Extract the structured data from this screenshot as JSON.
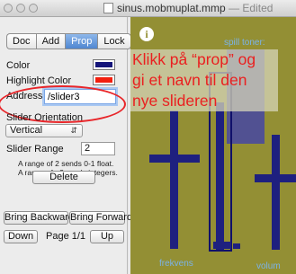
{
  "window": {
    "filename": "sinus.mobmuplat.mmp",
    "separator": "—",
    "state": "Edited"
  },
  "sidebar": {
    "tabs": [
      {
        "label": "Doc",
        "selected": false
      },
      {
        "label": "Add",
        "selected": false
      },
      {
        "label": "Prop",
        "selected": true
      },
      {
        "label": "Lock",
        "selected": false
      }
    ],
    "color_label": "Color",
    "color_value": "#15157a",
    "highlight_label": "Highlight Color",
    "highlight_value": "#f21e0e",
    "address_label": "Address",
    "address_value": "/slider3",
    "orientation_label": "Slider Orientation",
    "orientation_value": "Vertical",
    "range_label": "Slider Range",
    "range_value": "2",
    "range_note_1": "A range of 2 sends 0-1 float.",
    "range_note_2": "A range of >2 sends integers.",
    "delete_label": "Delete",
    "bring_backward_label": "Bring Backward",
    "bring_forward_label": "Bring Forward",
    "down_label": "Down",
    "page_label": "Page 1/1",
    "up_label": "Up"
  },
  "canvas": {
    "background": "#938f34",
    "info_glyph": "i",
    "spill_label": "spill toner:",
    "instruction_lines": [
      "Klikk på “prop” og",
      "gi et navn til den",
      "nye slideren"
    ],
    "label_left": "frekvens",
    "label_right": "volum"
  }
}
